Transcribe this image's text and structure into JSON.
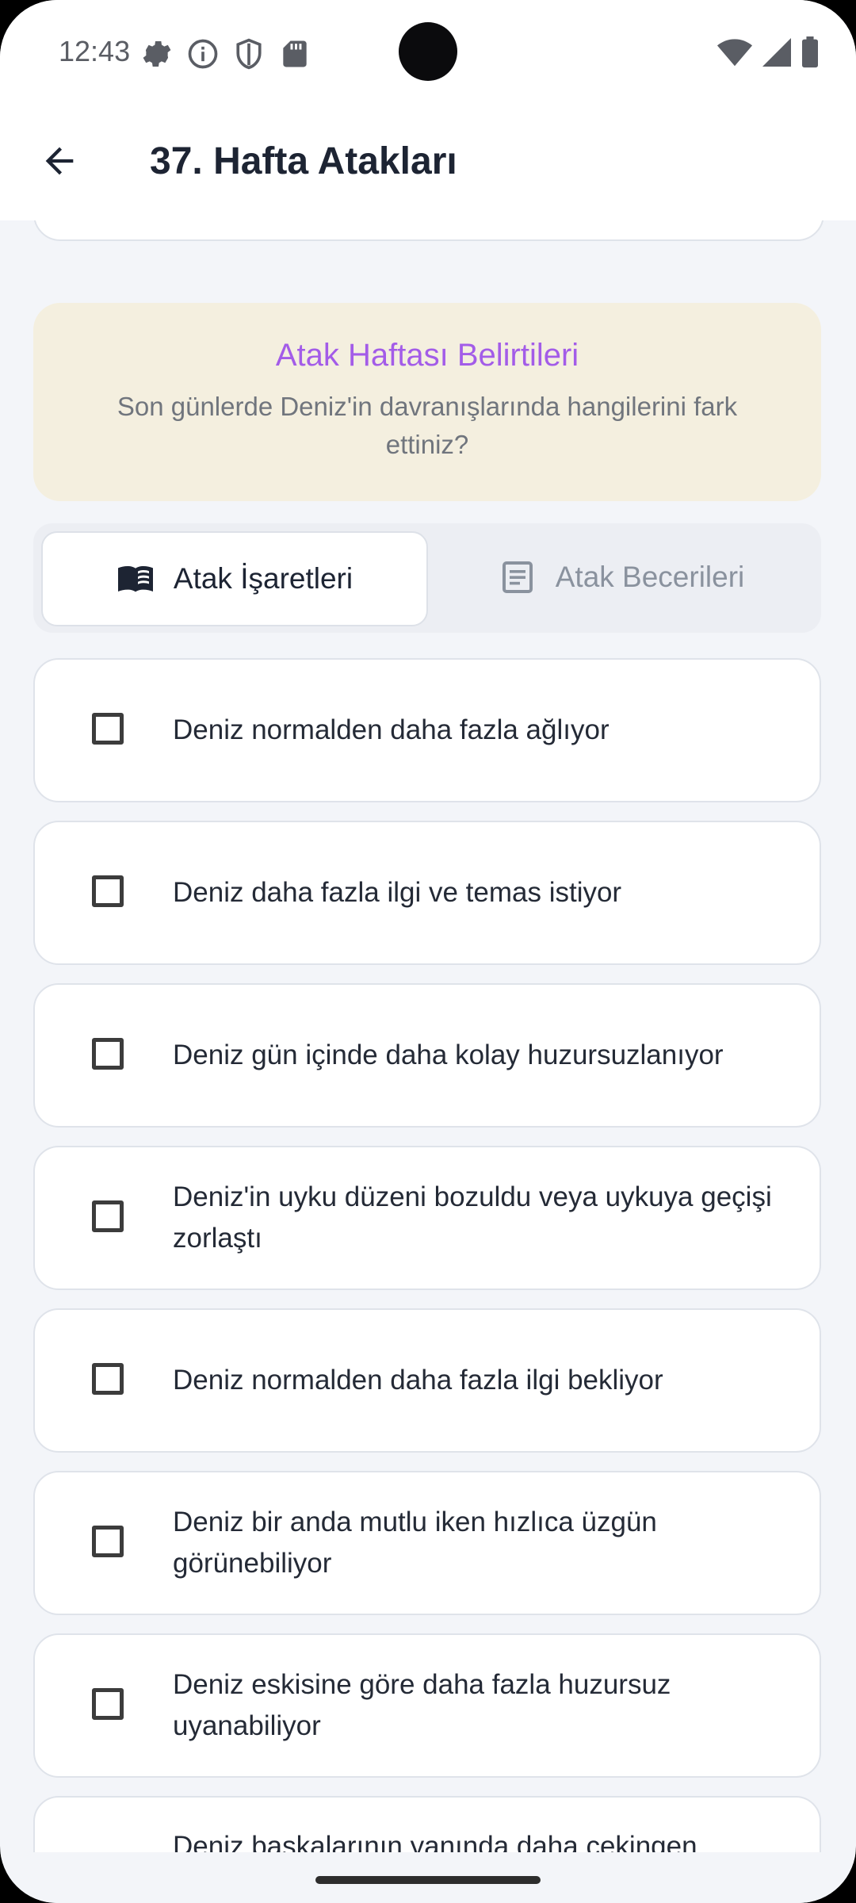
{
  "status_bar": {
    "time": "12:43",
    "left_icons": [
      "settings-icon",
      "info-icon",
      "shield-icon",
      "sd-card-icon"
    ],
    "right_icons": [
      "wifi-icon",
      "cellular-signal-icon",
      "battery-icon"
    ]
  },
  "app_bar": {
    "title": "37. Hafta Atakları",
    "back_icon": "arrow-left-icon"
  },
  "banner": {
    "title": "Atak Haftası Belirtileri",
    "subtitle": "Son günlerde Deniz'in davranışlarında hangilerini fark ettiniz?",
    "title_color": "#a35ce8",
    "background": "#f4efdf"
  },
  "tabs": [
    {
      "label": "Atak İşaretleri",
      "icon": "book-open-icon",
      "active": true
    },
    {
      "label": "Atak Becerileri",
      "icon": "document-list-icon",
      "active": false
    }
  ],
  "items": [
    {
      "label": "Deniz normalden daha fazla ağlıyor",
      "checked": false
    },
    {
      "label": "Deniz daha fazla ilgi ve temas istiyor",
      "checked": false
    },
    {
      "label": "Deniz gün içinde daha kolay huzursuzlanıyor",
      "checked": false
    },
    {
      "label": "Deniz'in uyku düzeni bozuldu veya uykuya geçişi zorlaştı",
      "checked": false
    },
    {
      "label": "Deniz normalden daha fazla ilgi bekliyor",
      "checked": false
    },
    {
      "label": "Deniz bir anda mutlu iken hızlıca üzgün görünebiliyor",
      "checked": false
    },
    {
      "label": "Deniz eskisine göre daha fazla huzursuz uyanabiliyor",
      "checked": false
    },
    {
      "label": "Deniz başkalarının yanında daha çekingen",
      "checked": false
    }
  ]
}
